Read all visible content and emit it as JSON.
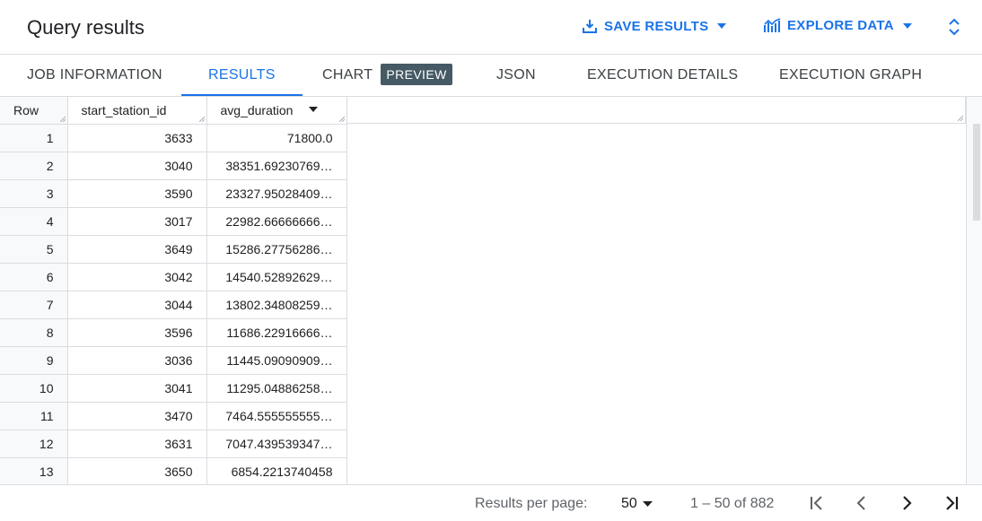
{
  "header": {
    "title": "Query results",
    "save_label": "SAVE RESULTS",
    "explore_label": "EXPLORE DATA",
    "icons": [
      "download-icon",
      "chart-icon",
      "caret-down-icon",
      "unfold-icon"
    ]
  },
  "tabs": [
    {
      "label": "JOB INFORMATION"
    },
    {
      "label": "RESULTS",
      "active": true
    },
    {
      "label": "CHART",
      "badge": "PREVIEW"
    },
    {
      "label": "JSON"
    },
    {
      "label": "EXECUTION DETAILS"
    },
    {
      "label": "EXECUTION GRAPH"
    }
  ],
  "table": {
    "columns": [
      "Row",
      "start_station_id",
      "avg_duration"
    ],
    "rows": [
      [
        "1",
        "3633",
        "71800.0"
      ],
      [
        "2",
        "3040",
        "38351.69230769…"
      ],
      [
        "3",
        "3590",
        "23327.95028409…"
      ],
      [
        "4",
        "3017",
        "22982.66666666…"
      ],
      [
        "5",
        "3649",
        "15286.27756286…"
      ],
      [
        "6",
        "3042",
        "14540.52892629…"
      ],
      [
        "7",
        "3044",
        "13802.34808259…"
      ],
      [
        "8",
        "3596",
        "11686.22916666…"
      ],
      [
        "9",
        "3036",
        "11445.09090909…"
      ],
      [
        "10",
        "3041",
        "11295.04886258…"
      ],
      [
        "11",
        "3470",
        "7464.555555555…"
      ],
      [
        "12",
        "3631",
        "7047.439539347…"
      ],
      [
        "13",
        "3650",
        "6854.2213740458"
      ]
    ]
  },
  "footer": {
    "rpp_label": "Results per page:",
    "rpp_value": "50",
    "range": "1 – 50 of 882"
  },
  "colors": {
    "accent": "#1a73e8",
    "badge": "#455a64",
    "border": "#dadce0"
  }
}
